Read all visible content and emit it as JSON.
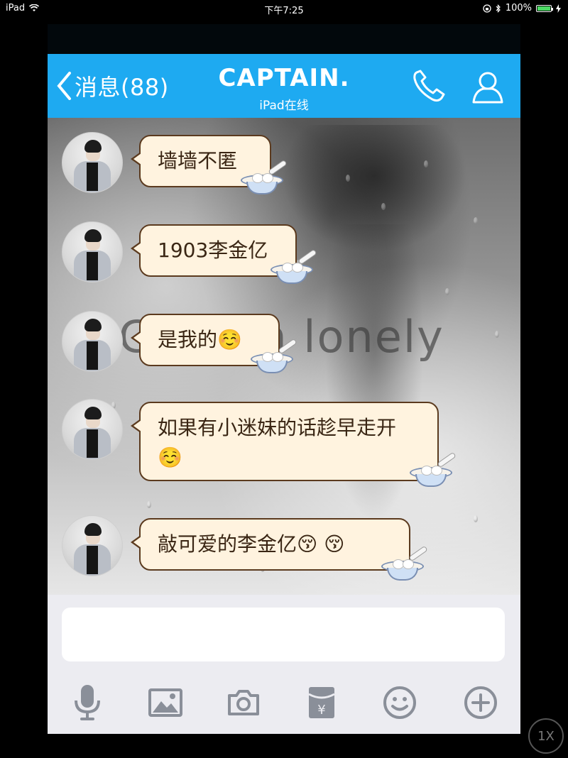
{
  "status_bar": {
    "device": "iPad",
    "time": "下午7:25",
    "battery": "100%",
    "battery_level": 1.0
  },
  "navbar": {
    "back_label": "消息(88)",
    "title": "CAPTAIN.",
    "subtitle": "iPad在线",
    "accent": "#1eaaf1"
  },
  "chat": {
    "background_text": "G... I'm lonely",
    "messages": [
      {
        "text": "墙墙不匿"
      },
      {
        "text": "1903李金亿"
      },
      {
        "text": "是我的☺️"
      },
      {
        "text": "如果有小迷妹的话趁早走开☺️"
      },
      {
        "text": "敲可爱的李金亿😚 😚"
      }
    ]
  },
  "composer": {
    "value": "",
    "placeholder": ""
  },
  "toolbar": {
    "icons": [
      "microphone-icon",
      "image-icon",
      "camera-icon",
      "red-packet-icon",
      "emoji-icon",
      "plus-icon"
    ]
  },
  "zoom_label": "1X"
}
